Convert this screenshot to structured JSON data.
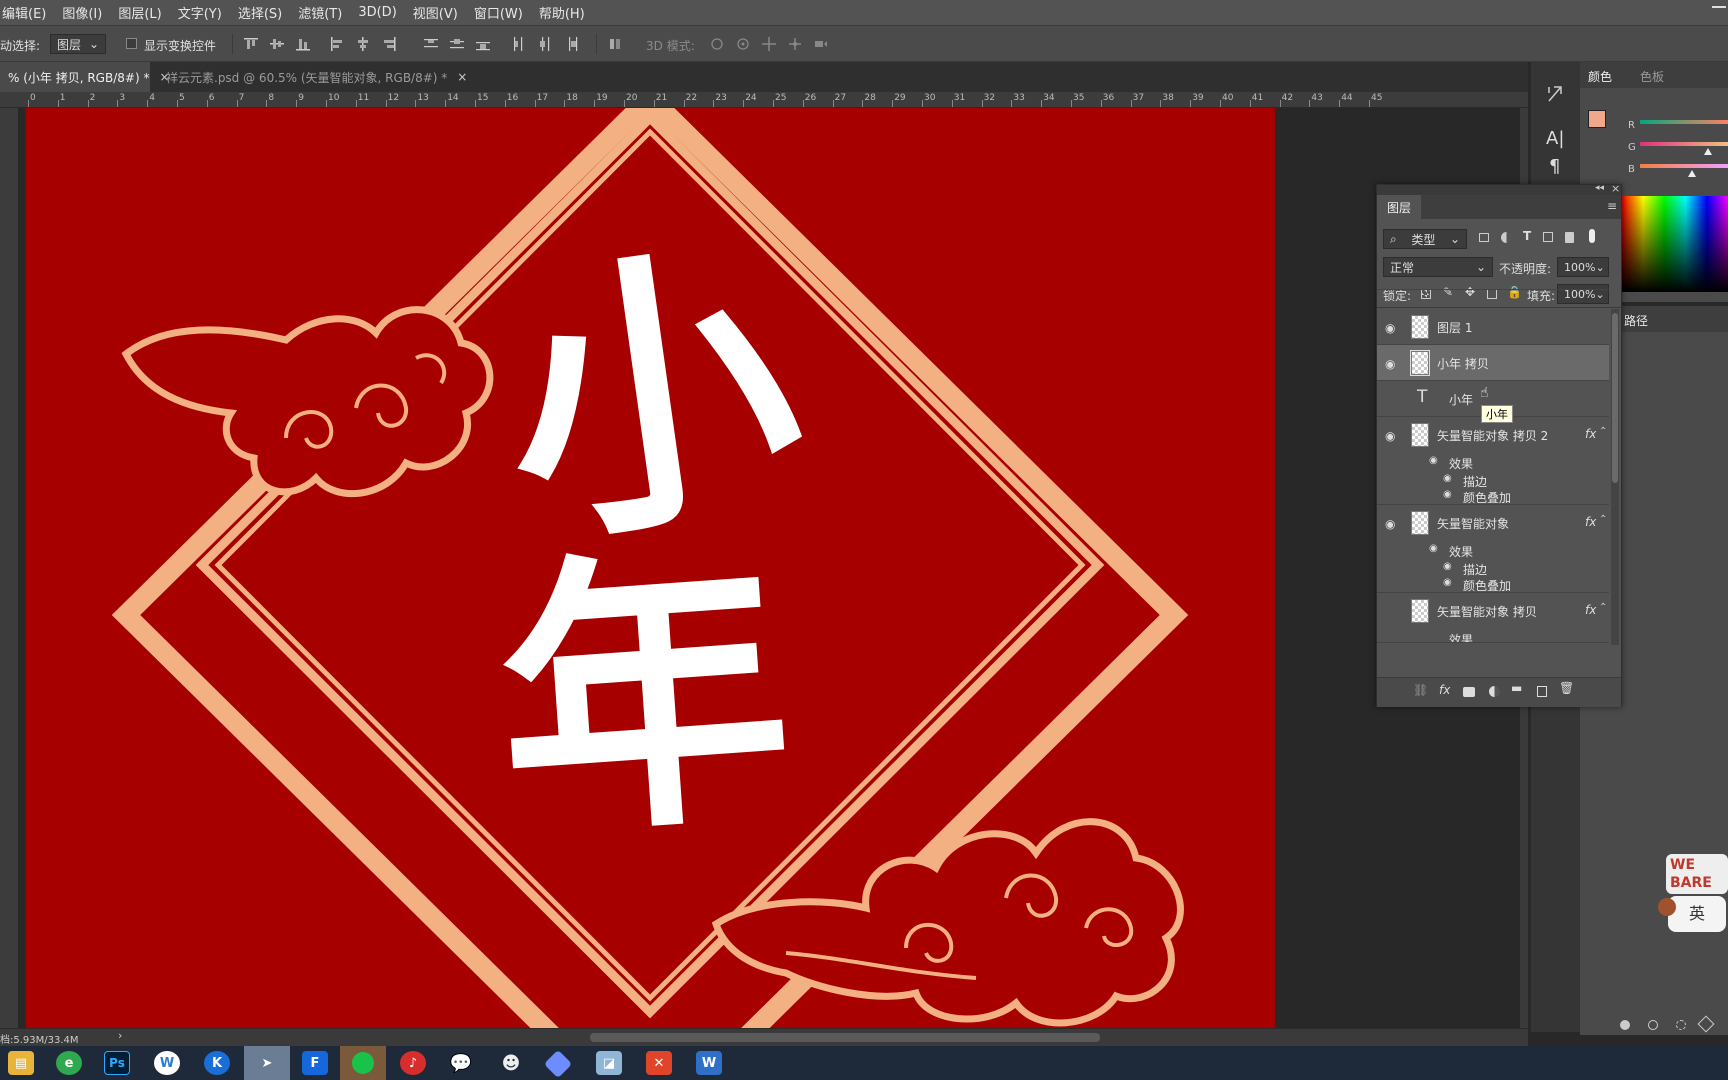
{
  "menu": [
    "编辑(E)",
    "图像(I)",
    "图层(L)",
    "文字(Y)",
    "选择(S)",
    "滤镜(T)",
    "3D(D)",
    "视图(V)",
    "窗口(W)",
    "帮助(H)"
  ],
  "options": {
    "auto_select_label": "动选择:",
    "auto_select_value": "图层",
    "show_transform_label": "显示变换控件",
    "mode_3d_label": "3D 模式:"
  },
  "tabs": [
    {
      "label": "% (小年 拷贝, RGB/8#) *",
      "active": true
    },
    {
      "label": "祥云元素.psd @ 60.5% (矢量智能对象, RGB/8#) *",
      "active": false
    }
  ],
  "ruler_ticks": [
    "0",
    "1",
    "2",
    "3",
    "4",
    "5",
    "6",
    "7",
    "8",
    "9",
    "10",
    "11",
    "12",
    "13",
    "14",
    "15",
    "16",
    "17",
    "18",
    "19",
    "20",
    "21",
    "22",
    "23",
    "24",
    "25",
    "26",
    "27",
    "28",
    "29",
    "30",
    "31",
    "32",
    "33",
    "34",
    "35",
    "36",
    "37",
    "38",
    "39",
    "40",
    "41",
    "42",
    "43",
    "44",
    "45"
  ],
  "artwork": {
    "title_chars": "小年",
    "bg_color": "#a60000",
    "accent_color": "#f3b183"
  },
  "color_panel": {
    "tab_color": "颜色",
    "tab_swatches": "色板",
    "channels": [
      "R",
      "G",
      "B"
    ],
    "fg_color": "#f0a88a"
  },
  "paths_panel": {
    "title": "路径"
  },
  "layers_panel": {
    "title": "图层",
    "filter_label": "类型",
    "blend_mode": "正常",
    "opacity_label": "不透明度:",
    "opacity_value": "100%",
    "lock_label": "锁定:",
    "fill_label": "填充:",
    "fill_value": "100%",
    "tooltip": "小年",
    "layers": [
      {
        "name": "图层 1",
        "visible": true,
        "kind": "raster"
      },
      {
        "name": "小年 拷贝",
        "visible": true,
        "kind": "raster",
        "selected": true
      },
      {
        "name": "小年",
        "visible": false,
        "kind": "text"
      },
      {
        "name": "矢量智能对象 拷贝 2",
        "visible": true,
        "kind": "smart",
        "fx": "fx",
        "effects_label": "效果",
        "effects": [
          "描边",
          "颜色叠加"
        ]
      },
      {
        "name": "矢量智能对象",
        "visible": true,
        "kind": "smart",
        "fx": "fx",
        "effects_label": "效果",
        "effects": [
          "描边",
          "颜色叠加"
        ]
      },
      {
        "name": "矢量智能对象 拷贝",
        "visible": false,
        "kind": "smart",
        "fx": "fx",
        "effects_label": "效果"
      }
    ]
  },
  "status": {
    "doc_size": "档:5.93M/33.4M"
  },
  "sticker_text": "英",
  "taskbar_icons": [
    "file-explorer-icon",
    "browser-icon",
    "photoshop-icon",
    "wps-icon",
    "k-app-icon",
    "feishu-icon",
    "f-app-icon",
    "green-app-icon",
    "netease-music-icon",
    "wechat-icon",
    "panda-icon",
    "gem-icon",
    "notebook-icon",
    "x-app-icon",
    "word-icon"
  ]
}
